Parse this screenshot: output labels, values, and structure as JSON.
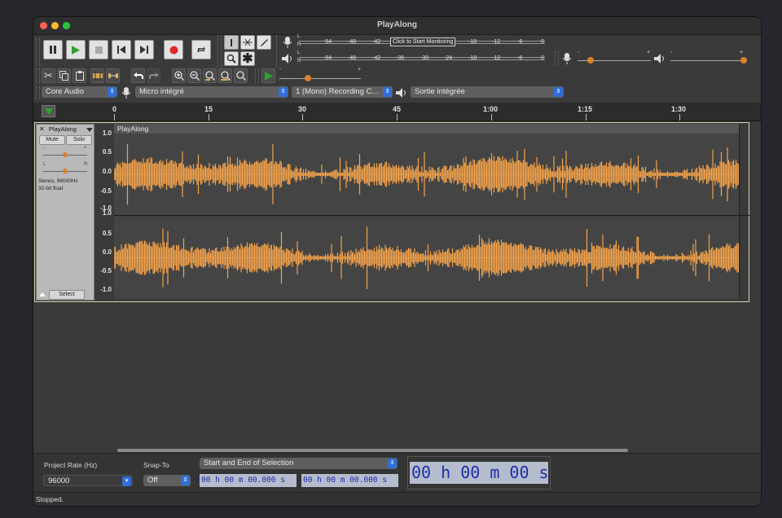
{
  "window": {
    "title": "PlayAlong"
  },
  "transport": {
    "buttons": [
      "pause",
      "play",
      "stop",
      "skip-to-start",
      "skip-to-end",
      "record",
      "loop"
    ]
  },
  "meters": {
    "record_ticks": [
      "-54",
      "-48",
      "-42",
      "-18",
      "-12",
      "-6",
      "0"
    ],
    "record_prompt": "Click to Start Monitoring",
    "play_ticks": [
      "-54",
      "-48",
      "-42",
      "-36",
      "-30",
      "-24",
      "-18",
      "-12",
      "-6",
      "0"
    ],
    "channel_left": "L",
    "channel_right": "R",
    "slider_minus": "-",
    "slider_plus": "+"
  },
  "device": {
    "host": "Core Audio",
    "input": "Micro intégré",
    "channels": "1 (Mono) Recording C...",
    "output": "Sortie intégrée"
  },
  "ruler": {
    "labels": [
      "0",
      "15",
      "30",
      "45",
      "1:00",
      "1:15",
      "1:30"
    ]
  },
  "track": {
    "name": "PlayAlong",
    "clip_name": "PlayAlong",
    "mute": "Mute",
    "solo": "Solo",
    "gain_minus": "-",
    "gain_plus": "+",
    "pan_left": "L",
    "pan_right": "R",
    "info_line1": "Stereo, 96000Hz",
    "info_line2": "32-bit float",
    "select": "Select",
    "scale": [
      "1.0",
      "0.5",
      "0.0",
      "-0.5",
      "-1.0"
    ]
  },
  "selection_bar": {
    "project_rate_label": "Project Rate (Hz)",
    "project_rate_value": "96000",
    "snap_label": "Snap-To",
    "snap_value": "Off",
    "selection_mode": "Start and End of Selection",
    "start_time": "00 h 00 m 00.000 s",
    "end_time": "00 h 00 m 00.000 s",
    "audio_position": "00 h 00 m 00 s"
  },
  "status": {
    "text": "Stopped."
  },
  "colors": {
    "waveform": "#f4a24a",
    "record": "#e0282a",
    "play": "#2ea12e",
    "accent": "#2f6fd8"
  }
}
